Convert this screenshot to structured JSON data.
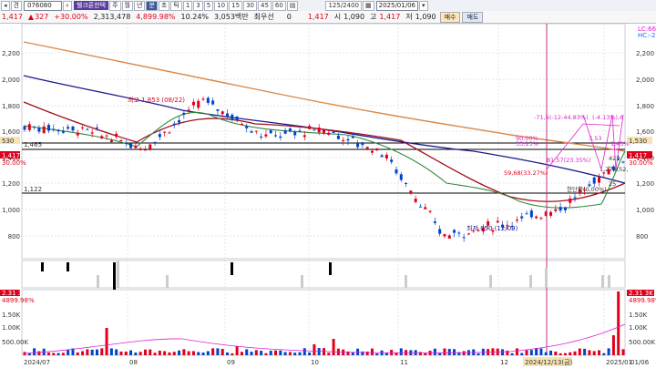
{
  "toolbar": {
    "arrow": "◂",
    "toggle": "견",
    "code": "076080",
    "stock_name": "웰크론한텍",
    "period_buttons": [
      "주",
      "월",
      "년",
      "분",
      "초",
      "틱"
    ],
    "minute_buttons": [
      "1",
      "3",
      "5",
      "10",
      "15",
      "30",
      "45",
      "60"
    ],
    "view_count": "125/2400",
    "date": "2025/01/06"
  },
  "quote": {
    "price": "1,417",
    "change": "327",
    "change_pct": "+30.00%",
    "volume": "2,313,478",
    "volume_pct": "4,899.98%",
    "turnover_pct": "10.24%",
    "amount": "3,053백만",
    "priority_label": "최우선",
    "priority_value": "0",
    "price2": "1,417",
    "open_label": "시",
    "open": "1,090",
    "high_label": "고",
    "high": "1,417",
    "low_label": "저",
    "low": "1,090",
    "buy_label": "매수",
    "sell_label": "매도"
  },
  "chart_labels": {
    "y_axis": [
      "2,200",
      "2,000",
      "1,800",
      "1,600",
      "1,400",
      "1,200",
      "1,000",
      "800"
    ],
    "right_axis": [
      "2,200",
      "2,000",
      "1,800",
      "1,600",
      "1,400",
      "1,200",
      "1,000",
      "800"
    ],
    "left_price_tags": [
      "530",
      "1,465",
      "1,417",
      "30.00%",
      "1,122"
    ],
    "right_price_tags": [
      "1,530",
      "1,417",
      "30.00%"
    ],
    "top_right": [
      "LC:66.71",
      "HC:-23.53"
    ],
    "high_note": "최고 1,853 (08/22)",
    "low_note": "최저 850 (12/09)",
    "annotations": [
      "-71,6(-12-44.83%)",
      "(-4.13%)",
      ",6",
      "90,00%",
      "33,13%",
      "3,53",
      "1,43%",
      "81,57(23.35%)",
      "422",
      "59,68(33.27%)",
      "1,278(52,",
      "현단락(0,00%)",
      "25"
    ],
    "volume_axis": [
      "2.31 3K",
      "4899.98%",
      "1.50K",
      "1.00K",
      "500.00K"
    ],
    "x_axis": [
      "2024/07",
      "08",
      "09",
      "10",
      "11",
      "12",
      "2024/12/13(금)",
      "2025/01",
      "01/06"
    ]
  },
  "colors": {
    "rise": "#e0001b",
    "fall": "#0044cc",
    "ma_orange": "#d9894a",
    "ma_navy": "#1a1a8c",
    "ma_darkred": "#a01020",
    "ma_green": "#2e8b3e",
    "annotation_magenta": "#e020d0"
  },
  "chart_data": {
    "type": "candlestick",
    "dates": [
      "2024-07-01",
      "2024-07-15",
      "2024-08-01",
      "2024-08-22",
      "2024-09-01",
      "2024-10-01",
      "2024-11-01",
      "2024-12-09",
      "2024-12-13",
      "2025-01-03",
      "2025-01-06"
    ],
    "close": [
      1620,
      1600,
      1480,
      1800,
      1560,
      1600,
      1450,
      900,
      980,
      1090,
      1417
    ],
    "ylim": [
      750,
      2300
    ],
    "high_marker": {
      "date": "2024-08-22",
      "value": 1853
    },
    "low_marker": {
      "date": "2024-12-09",
      "value": 850
    },
    "horizontal_levels": [
      1465,
      1417,
      1122
    ],
    "volume_ylim": [
      0,
      2313478
    ]
  }
}
